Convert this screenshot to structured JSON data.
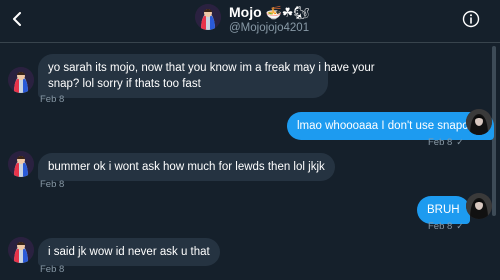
{
  "header": {
    "name": "Mojo",
    "name_emojis": "🍜☘🐿",
    "handle": "@Mojojojo4201",
    "back_icon": "chevron-left-icon",
    "info_icon": "info-icon"
  },
  "messages": [
    {
      "direction": "in",
      "lines": [
        "yo sarah its mojo, now that you know im a freak may i have your",
        "snap? lol sorry if thats too fast"
      ],
      "time": "Feb 8"
    },
    {
      "direction": "out",
      "text": "lmao whoooaaa I don't use snapchat",
      "time": "Feb 8",
      "status_icon": "check-icon"
    },
    {
      "direction": "in",
      "text": "bummer ok i wont ask how much for lewds then lol jkjk",
      "time": "Feb 8"
    },
    {
      "direction": "out",
      "text": "BRUH",
      "time": "Feb 8",
      "status_icon": "check-icon"
    },
    {
      "direction": "in",
      "text": "i said jk wow  id never ask u that",
      "time": "Feb 8"
    }
  ],
  "colors": {
    "background": "#15202b",
    "incoming_bubble": "#253341",
    "outgoing_bubble": "#1d9bf0",
    "secondary_text": "#8899a6"
  }
}
